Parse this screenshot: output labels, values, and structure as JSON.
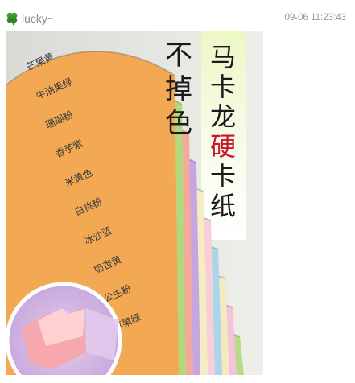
{
  "review": {
    "username": "lucky~",
    "timestamp": "09-06 11:23:43",
    "avatar_icon": "four-leaf-clover-icon"
  },
  "photo": {
    "headline_left": [
      "不",
      "掉",
      "色"
    ],
    "headline_right": [
      "马",
      "卡",
      "龙",
      "硬",
      "卡",
      "纸"
    ],
    "highlight_color": "#c8182a",
    "cards": [
      {
        "name": "芒果黄",
        "color": "#f3a953"
      },
      {
        "name": "牛油果绿",
        "color": "#b3d77d"
      },
      {
        "name": "珊瑚粉",
        "color": "#f5a89c"
      },
      {
        "name": "香芋紫",
        "color": "#c5a6e0"
      },
      {
        "name": "米黄色",
        "color": "#f5ecc4"
      },
      {
        "name": "白桃粉",
        "color": "#f9cfd7"
      },
      {
        "name": "冰沙蓝",
        "color": "#a9d6ea"
      },
      {
        "name": "奶杏黄",
        "color": "#f6e8bf"
      },
      {
        "name": "公主粉",
        "color": "#f3c4d8"
      },
      {
        "name": "苹果绿",
        "color": "#b6dc86"
      }
    ]
  }
}
